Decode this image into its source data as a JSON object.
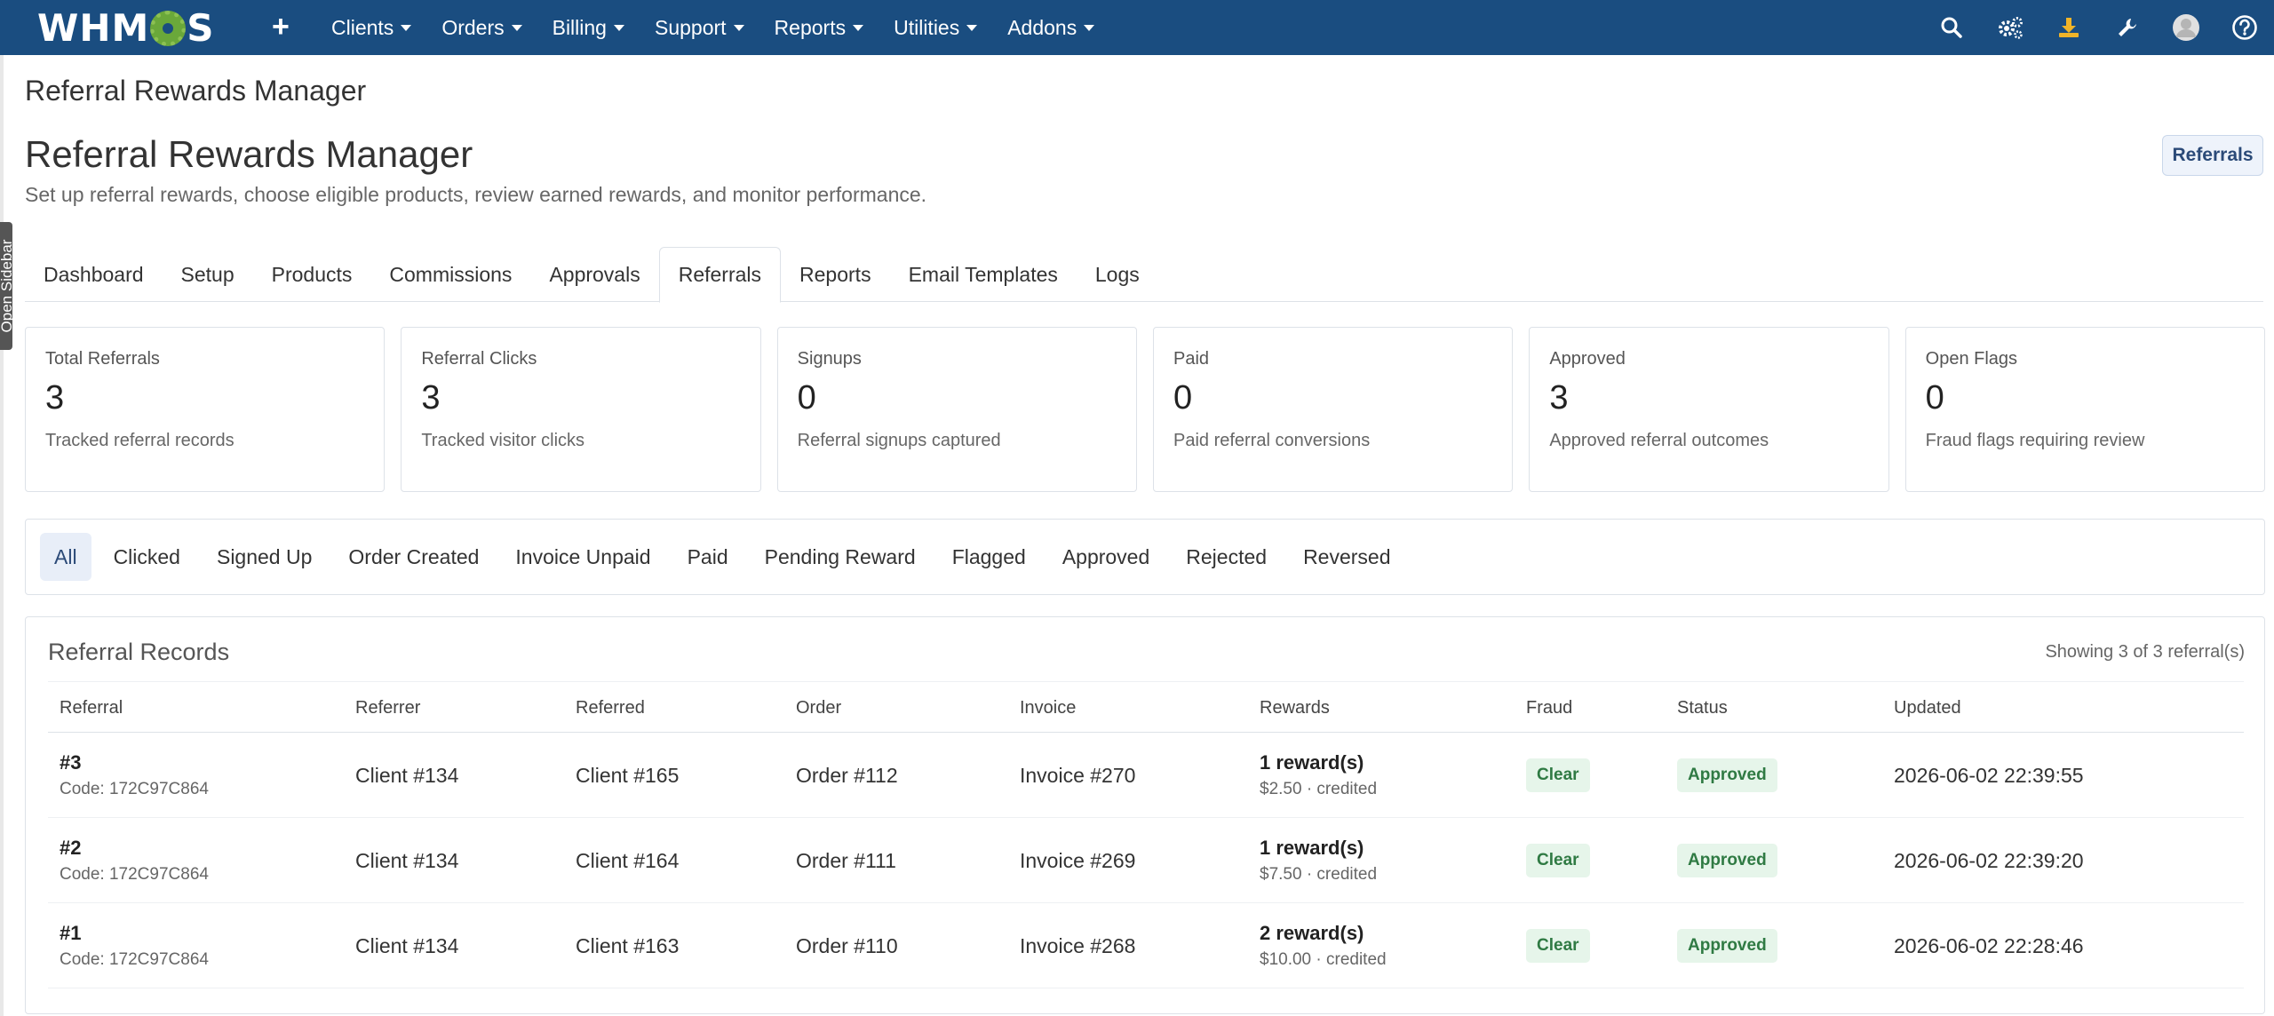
{
  "nav": {
    "logo_text_left": "WHM",
    "logo_text_right": "S",
    "plus_label": "+",
    "menu": [
      {
        "label": "Clients"
      },
      {
        "label": "Orders"
      },
      {
        "label": "Billing"
      },
      {
        "label": "Support"
      },
      {
        "label": "Reports"
      },
      {
        "label": "Utilities"
      },
      {
        "label": "Addons"
      }
    ],
    "icons": [
      "search-icon",
      "cogs-icon",
      "download-icon",
      "wrench-icon",
      "avatar-icon",
      "help-icon"
    ],
    "color": "#1a4d80"
  },
  "sidebar_toggle": "Open Sidebar",
  "page": {
    "crumb": "Referral Rewards Manager",
    "title": "Referral Rewards Manager",
    "subtitle": "Set up referral rewards, choose eligible products, review earned rewards, and monitor performance.",
    "referrals_button": "Referrals"
  },
  "tabs": [
    {
      "label": "Dashboard"
    },
    {
      "label": "Setup"
    },
    {
      "label": "Products"
    },
    {
      "label": "Commissions"
    },
    {
      "label": "Approvals"
    },
    {
      "label": "Referrals",
      "active": true
    },
    {
      "label": "Reports"
    },
    {
      "label": "Email Templates"
    },
    {
      "label": "Logs"
    }
  ],
  "stats": [
    {
      "label": "Total Referrals",
      "value": "3",
      "desc": "Tracked referral records"
    },
    {
      "label": "Referral Clicks",
      "value": "3",
      "desc": "Tracked visitor clicks"
    },
    {
      "label": "Signups",
      "value": "0",
      "desc": "Referral signups captured"
    },
    {
      "label": "Paid",
      "value": "0",
      "desc": "Paid referral conversions"
    },
    {
      "label": "Approved",
      "value": "3",
      "desc": "Approved referral outcomes"
    },
    {
      "label": "Open Flags",
      "value": "0",
      "desc": "Fraud flags requiring review"
    }
  ],
  "filters": [
    {
      "label": "All",
      "active": true
    },
    {
      "label": "Clicked"
    },
    {
      "label": "Signed Up"
    },
    {
      "label": "Order Created"
    },
    {
      "label": "Invoice Unpaid"
    },
    {
      "label": "Paid"
    },
    {
      "label": "Pending Reward"
    },
    {
      "label": "Flagged"
    },
    {
      "label": "Approved"
    },
    {
      "label": "Rejected"
    },
    {
      "label": "Reversed"
    }
  ],
  "records": {
    "title": "Referral Records",
    "count_text": "Showing 3 of 3 referral(s)",
    "columns": [
      "Referral",
      "Referrer",
      "Referred",
      "Order",
      "Invoice",
      "Rewards",
      "Fraud",
      "Status",
      "Updated"
    ],
    "rows": [
      {
        "id": "#3",
        "code": "Code: 172C97C864",
        "referrer": "Client #134",
        "referred": "Client #165",
        "order": "Order #112",
        "invoice": "Invoice #270",
        "rewards": "1 reward(s)",
        "rewards_sub": "$2.50 · credited",
        "fraud": "Clear",
        "status": "Approved",
        "updated": "2026-06-02 22:39:55"
      },
      {
        "id": "#2",
        "code": "Code: 172C97C864",
        "referrer": "Client #134",
        "referred": "Client #164",
        "order": "Order #111",
        "invoice": "Invoice #269",
        "rewards": "1 reward(s)",
        "rewards_sub": "$7.50 · credited",
        "fraud": "Clear",
        "status": "Approved",
        "updated": "2026-06-02 22:39:20"
      },
      {
        "id": "#1",
        "code": "Code: 172C97C864",
        "referrer": "Client #134",
        "referred": "Client #163",
        "order": "Order #110",
        "invoice": "Invoice #268",
        "rewards": "2 reward(s)",
        "rewards_sub": "$10.00 · credited",
        "fraud": "Clear",
        "status": "Approved",
        "updated": "2026-06-02 22:28:46"
      }
    ]
  }
}
